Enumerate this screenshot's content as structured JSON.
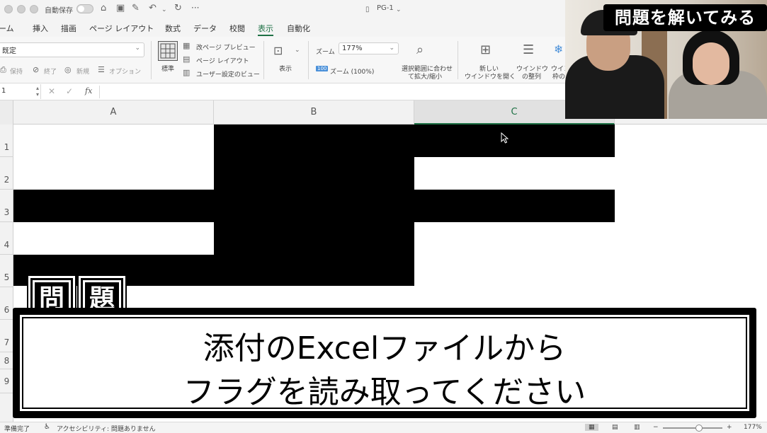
{
  "titlebar": {
    "autosave_label": "自動保存",
    "document_title": "PG-1",
    "more": "···"
  },
  "tabs": [
    {
      "label": "ーム"
    },
    {
      "label": "挿入"
    },
    {
      "label": "描画"
    },
    {
      "label": "ページ レイアウト"
    },
    {
      "label": "数式"
    },
    {
      "label": "データ"
    },
    {
      "label": "校閲"
    },
    {
      "label": "表示",
      "active": true
    },
    {
      "label": "自動化"
    }
  ],
  "ribbon": {
    "sheet_view_select": "既定",
    "sheet_view_actions": [
      "保持",
      "終了",
      "新規",
      "オプション"
    ],
    "standard_label": "標準",
    "page_break_preview": "改ページ プレビュー",
    "page_layout": "ページ レイアウト",
    "custom_view": "ユーザー設定のビュー",
    "show_label": "表示",
    "zoom_label": "ズーム",
    "zoom_value": "177%",
    "zoom_100_badge": "100",
    "zoom_100": "ズーム (100%)",
    "zoom_selection_l1": "選択範囲に合わせ",
    "zoom_selection_l2": "て拡大/縮小",
    "new_window_l1": "新しい",
    "new_window_l2": "ウインドウを開く",
    "arrange_l1": "ウインドウ",
    "arrange_l2": "の整列",
    "freeze_l1": "ウイン",
    "freeze_l2": "枠の"
  },
  "formula_bar": {
    "name_box": "1",
    "fx": "fx",
    "formula": ""
  },
  "grid": {
    "columns": [
      "A",
      "B",
      "C"
    ],
    "selected_column": "C",
    "rows": [
      "1",
      "2",
      "3",
      "4",
      "5",
      "6",
      "7",
      "8",
      "9"
    ]
  },
  "statusbar": {
    "ready": "準備完了",
    "accessibility": "アクセシビリティ: 問題ありません",
    "zoom": "177%",
    "minus": "−",
    "plus": "+"
  },
  "webcam": {
    "badge": "問題を解いてみる"
  },
  "question": {
    "badge_chars": [
      "問",
      "題"
    ],
    "line1": "添付のExcelファイルから",
    "line2": "フラグを読み取ってください"
  },
  "colors": {
    "accent": "#1e7145",
    "fill": "#000000"
  }
}
